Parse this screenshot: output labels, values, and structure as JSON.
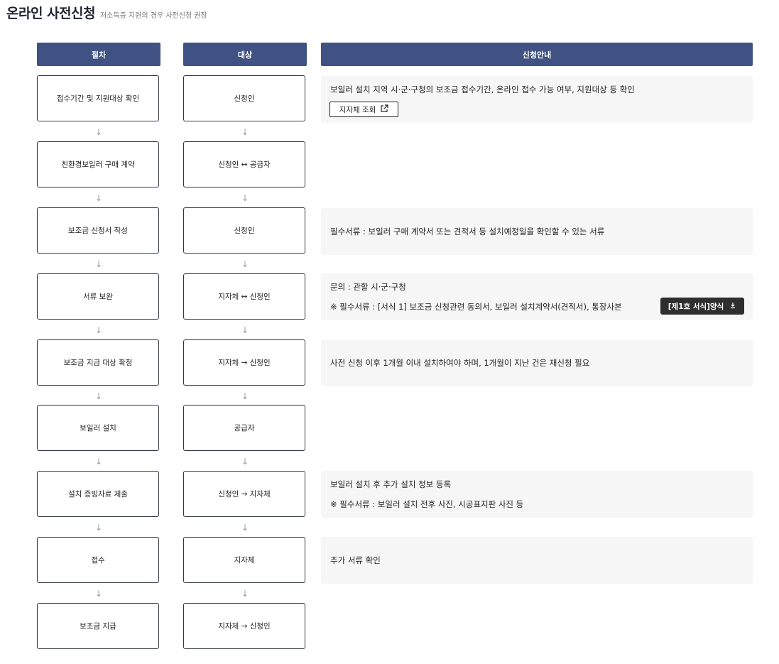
{
  "page": {
    "title": "온라인 사전신청",
    "subtitle": "저소득층 지원의 경우 사전신청 권장"
  },
  "headers": {
    "step": "절차",
    "target": "대상",
    "guide": "신청안내"
  },
  "arrow_glyph": "↓",
  "steps": [
    {
      "step": "접수기간 및 지원대상 확인",
      "target": "신청인"
    },
    {
      "step": "친환경보일러 구매 계약",
      "target": "신청인 ↔ 공급자"
    },
    {
      "step": "보조금 신청서 작성",
      "target": "신청인"
    },
    {
      "step": "서류 보완",
      "target": "지자체 ↔ 신청인"
    },
    {
      "step": "보조금 지급 대상 확정",
      "target": "지자체 → 신청인"
    },
    {
      "step": "보일러 설치",
      "target": "공급자"
    },
    {
      "step": "설치 증빙자료 제출",
      "target": "신청인 → 지자체"
    },
    {
      "step": "접수",
      "target": "지자체"
    },
    {
      "step": "보조금 지급",
      "target": "지자체 → 신청인"
    }
  ],
  "guides": {
    "g1": {
      "text": "보일러 설치 지역 시·군·구청의 보조금 접수기간, 온라인 접수 가능 여부, 지원대상 등 확인",
      "button": "지자체 조회",
      "button_icon": "external-link-icon"
    },
    "g3": {
      "text": "필수서류 : 보일러 구매 계약서 또는 견적서 등 설치예정일을 확인할 수 있는 서류"
    },
    "g4": {
      "line1": "문의 : 관할 시·군·구청",
      "line2": "※ 필수서류 : [서식 1] 보조금 신청관련 동의서, 보일러 설치계약서(견적서), 통장사본",
      "button": "[제1호 서식]양식",
      "button_icon": "download-icon"
    },
    "g5": {
      "text": "사전 신청 이후 1개월 이내 설치하여야 하며, 1개월이 지난 건은 재신청 필요"
    },
    "g7": {
      "line1": "보일러 설치 후 추가 설치 정보 등록",
      "line2": "※ 필수서류 : 보일러 설치 전후 사진, 시공표지판 사진 등"
    },
    "g8": {
      "text": "추가 서류 확인"
    }
  },
  "colors": {
    "header_bg": "#3f5283",
    "info_bg": "#f6f6f6",
    "dark_button": "#2e2e2e"
  }
}
